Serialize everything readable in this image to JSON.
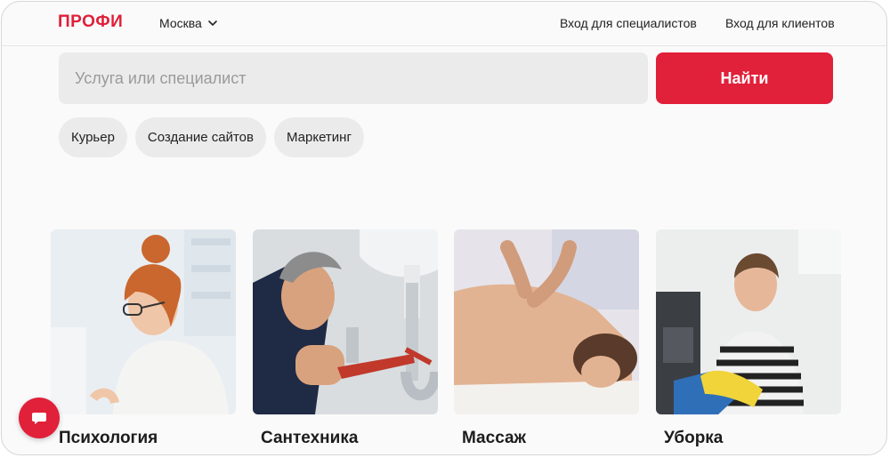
{
  "header": {
    "logo": "ПРОФИ",
    "city": "Москва",
    "specialists_link": "Вход для специалистов",
    "clients_link": "Вход для клиентов"
  },
  "search": {
    "placeholder": "Услуга или специалист",
    "button": "Найти"
  },
  "chips": [
    "Курьер",
    "Создание сайтов",
    "Маркетинг"
  ],
  "categories": [
    {
      "label": "Психология",
      "icon": "psychology-photo"
    },
    {
      "label": "Сантехника",
      "icon": "plumbing-photo"
    },
    {
      "label": "Массаж",
      "icon": "massage-photo"
    },
    {
      "label": "Уборка",
      "icon": "cleaning-photo"
    }
  ],
  "colors": {
    "accent": "#e1203a",
    "field": "#ebebeb",
    "text": "#222222"
  },
  "icons": {
    "city_toggle": "chevron-down-icon",
    "chat": "chat-bubble-icon"
  }
}
